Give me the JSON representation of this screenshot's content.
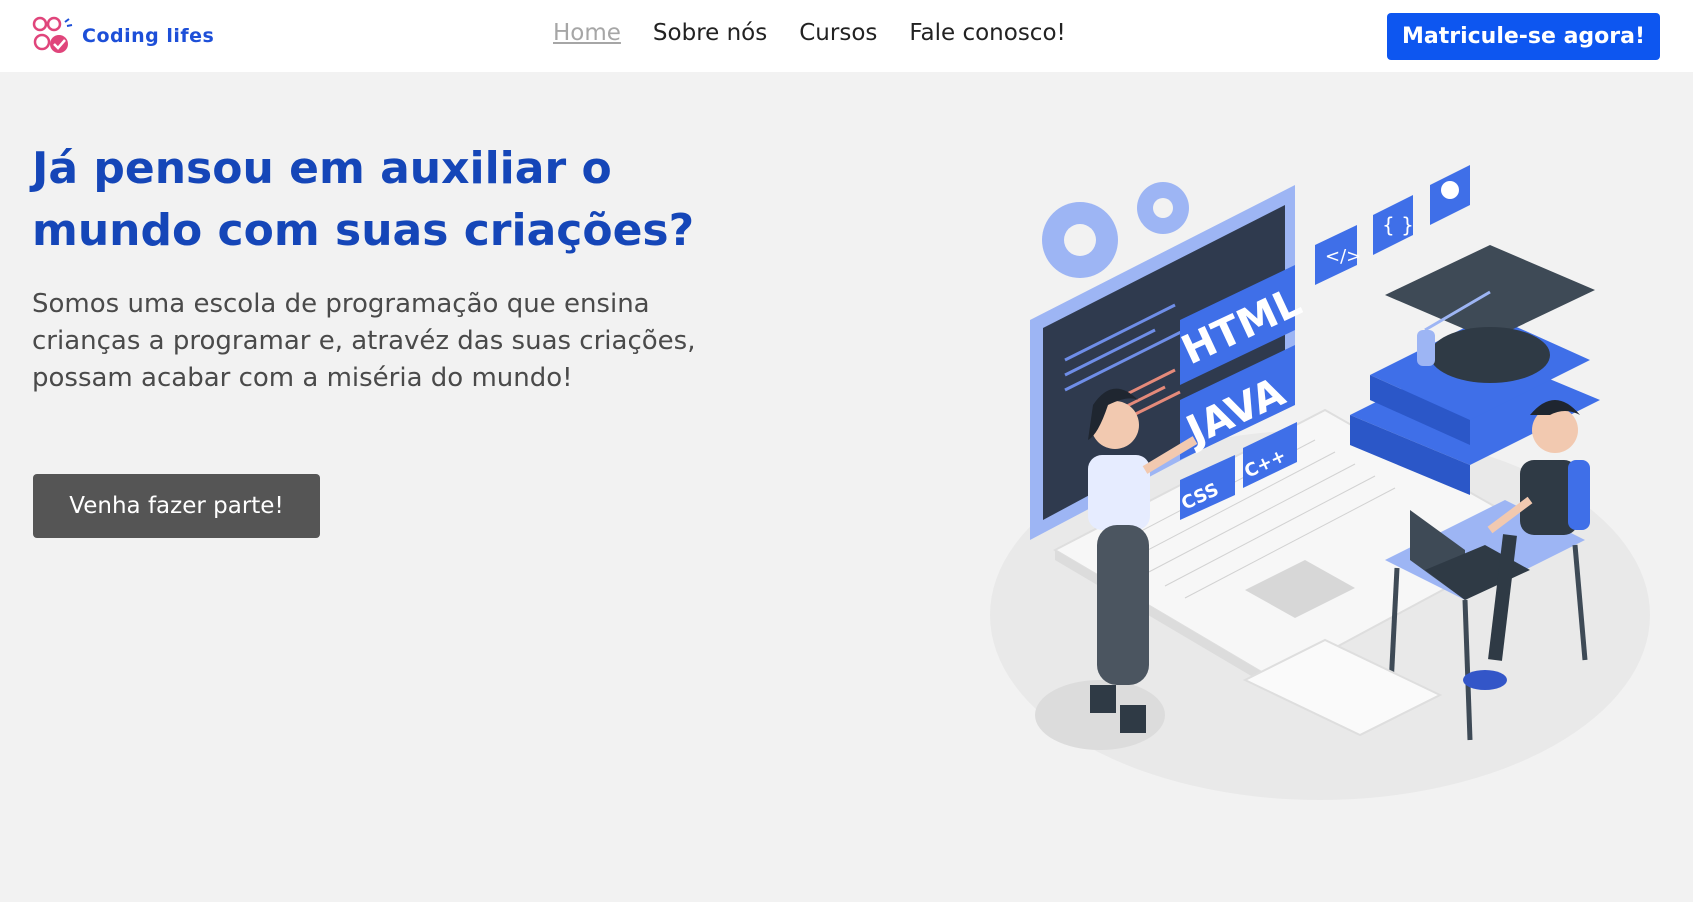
{
  "header": {
    "logo_text": "Coding lifes",
    "nav": [
      {
        "label": "Home",
        "active": true
      },
      {
        "label": "Sobre nós",
        "active": false
      },
      {
        "label": "Cursos",
        "active": false
      },
      {
        "label": "Fale conosco!",
        "active": false
      }
    ],
    "cta_label": "Matricule-se agora!"
  },
  "hero": {
    "headline": "Já pensou em auxiliar o mundo com suas criações?",
    "subtitle": "Somos uma escola de programação que ensina crianças a programar e, atravéz das suas criações, possam acabar com a miséria do mundo!",
    "button_label": "Venha fazer parte!"
  },
  "illustration": {
    "tags": [
      "HTML",
      "JAVA",
      "CSS",
      "C++"
    ]
  },
  "colors": {
    "accent": "#0d56f0",
    "headline": "#1546b8",
    "button": "#555555",
    "background": "#f2f2f2",
    "illustration_blue": "#3f6fe8",
    "illustration_light": "#9db5f4"
  }
}
